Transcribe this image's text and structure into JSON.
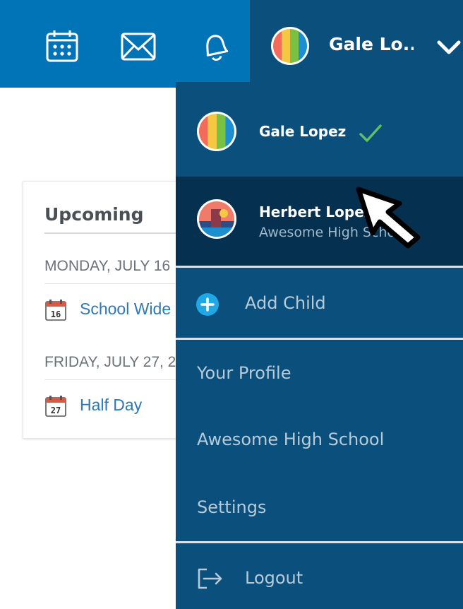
{
  "header": {
    "icons": [
      "calendar-icon",
      "mail-icon",
      "bell-icon"
    ],
    "user_name": "Gale Lo...",
    "chevron": "chevron-down-icon"
  },
  "upcoming": {
    "title": "Upcoming",
    "days": [
      {
        "date_label": "MONDAY, JULY 16",
        "event": {
          "day_number": "16",
          "label": "School Wide"
        }
      },
      {
        "date_label": "FRIDAY, JULY 27, 2",
        "event": {
          "day_number": "27",
          "label": "Half Day"
        }
      }
    ]
  },
  "dropdown": {
    "accounts": [
      {
        "name": "Gale Lopez",
        "selected": true
      },
      {
        "name": "Herbert Lopez",
        "school": "Awesome High School",
        "hovered": true
      }
    ],
    "add_child_label": "Add Child",
    "links": [
      "Your Profile",
      "Awesome High School",
      "Settings"
    ],
    "logout_label": "Logout"
  },
  "colors": {
    "topbar": "#0074b7",
    "menu_bg": "#0b4f7d",
    "menu_hover": "#06304f",
    "check": "#5bc25f",
    "add_icon": "#1fa7e6",
    "link_blue": "#2f78b6"
  }
}
